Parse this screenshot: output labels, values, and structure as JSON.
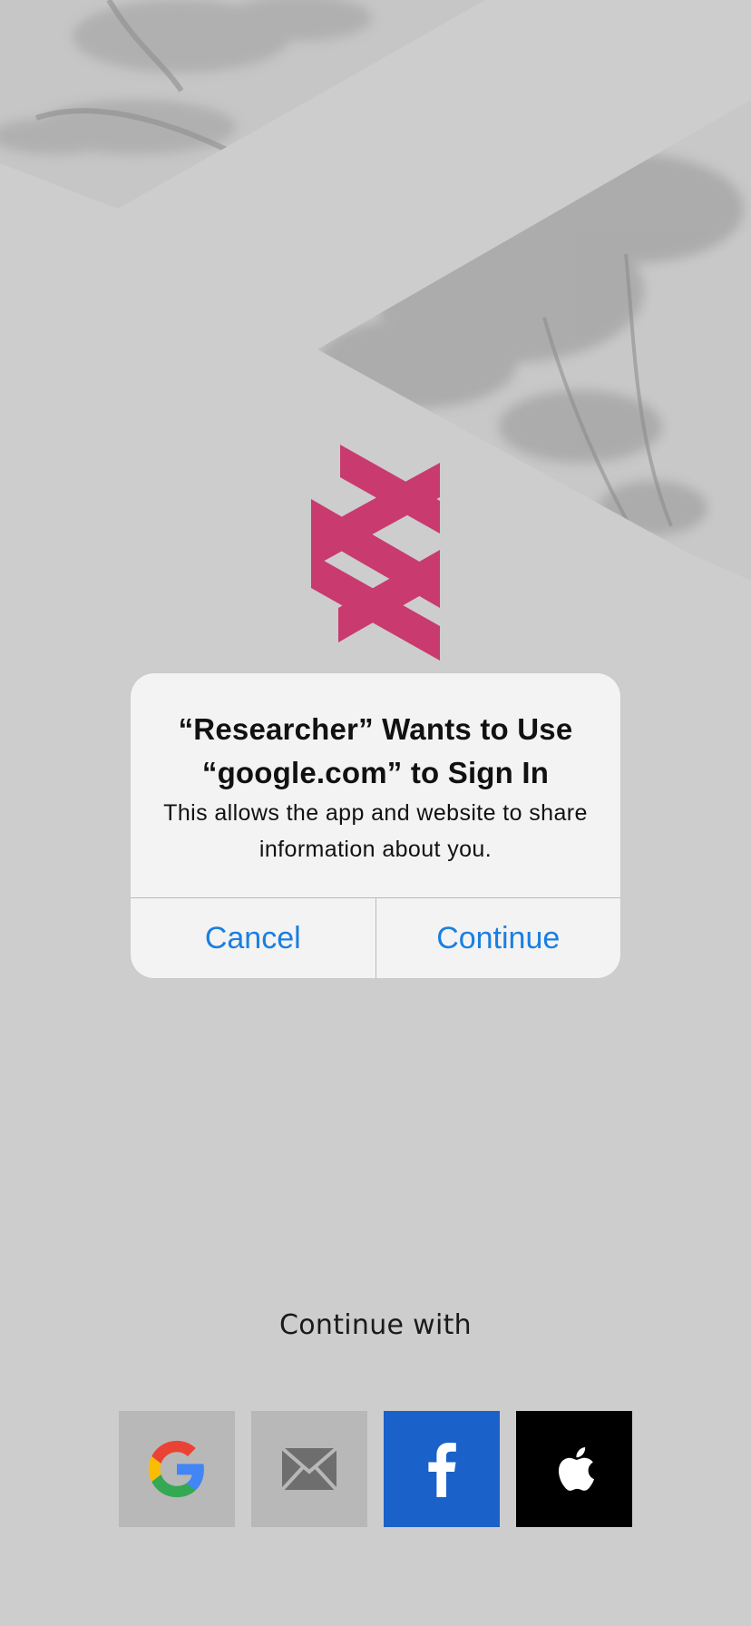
{
  "dialog": {
    "title": "“Researcher” Wants to Use “google.com” to Sign In",
    "message": "This allows the app and website to share information about you.",
    "cancel_label": "Cancel",
    "continue_label": "Continue"
  },
  "login": {
    "continue_with_label": "Continue with",
    "providers": [
      {
        "name": "google",
        "icon": "google-icon",
        "bg": "#b8b8b8"
      },
      {
        "name": "email",
        "icon": "envelope-icon",
        "bg": "#b8b8b8"
      },
      {
        "name": "facebook",
        "icon": "facebook-icon",
        "bg": "#1a61c9"
      },
      {
        "name": "apple",
        "icon": "apple-icon",
        "bg": "#000000"
      }
    ]
  },
  "colors": {
    "accent": "#1a7fe0",
    "brand": "#c93a6e",
    "background": "#cdcdcd"
  }
}
